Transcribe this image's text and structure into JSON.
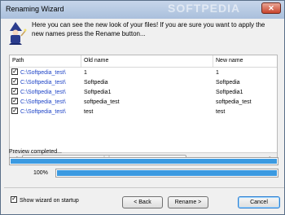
{
  "window": {
    "title": "Renaming Wizard",
    "watermark": "SOFTPEDIA",
    "close_label": "✕"
  },
  "intro": {
    "text": "Here you can see the new look of your files! If you are sure you want to apply the new names press the Rename button..."
  },
  "list": {
    "columns": [
      "Path",
      "Old name",
      "New name"
    ],
    "rows": [
      {
        "path": "C:\\Softpedia_test\\",
        "old": "1",
        "new": "1"
      },
      {
        "path": "C:\\Softpedia_test\\",
        "old": "Softpedia",
        "new": "Softpedia"
      },
      {
        "path": "C:\\Softpedia_test\\",
        "old": "Softpedia1",
        "new": "Softpedia1"
      },
      {
        "path": "C:\\Softpedia_test\\",
        "old": "softpedia_test",
        "new": "softpedia_test"
      },
      {
        "path": "C:\\Softpedia_test\\",
        "old": "test",
        "new": "test"
      }
    ]
  },
  "status": {
    "preview_text": "Preview completed...",
    "percent_label": "100%",
    "preview_progress": 1.0,
    "overall_progress": 1.0
  },
  "footer": {
    "show_wizard_label": "Show wizard on startup",
    "back_label": "< Back",
    "rename_label": "Rename >",
    "cancel_label": "Cancel"
  },
  "colors": {
    "path_text": "#1e44c7",
    "progress_fill": "#3b9ae1"
  }
}
